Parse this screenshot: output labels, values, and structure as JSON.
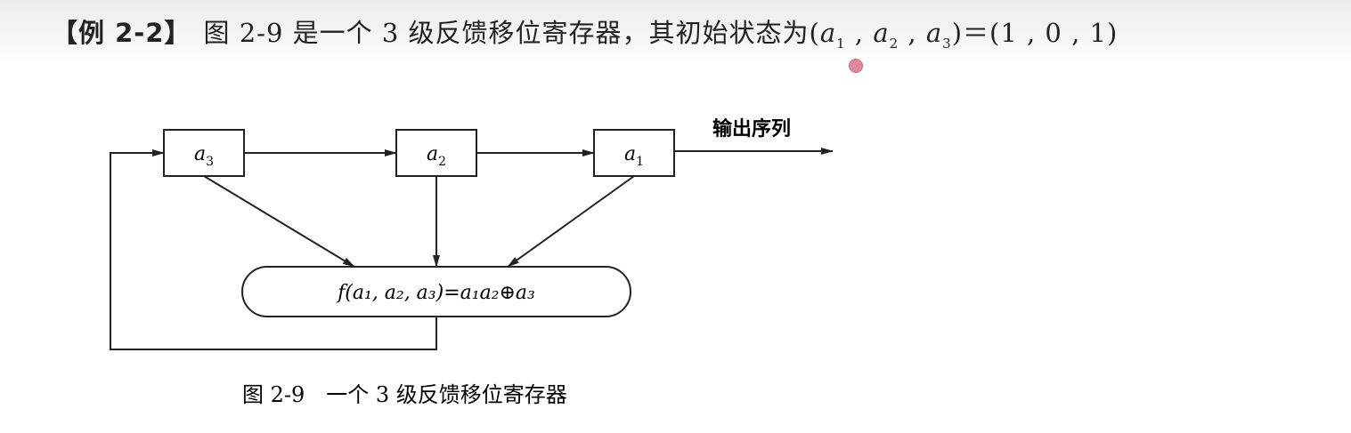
{
  "header": {
    "example_label": "【例 2-2】",
    "text_intro": "图 2-9 是一个 3 级反馈移位寄存器，其初始状态为(",
    "var_a": "a",
    "sub1": "1",
    "sub2": "2",
    "sub3": "3",
    "sep": " , ",
    "text_mid": ")＝(",
    "state_values": "1 , 0 , 1",
    "text_end": ")"
  },
  "diagram": {
    "registers": [
      {
        "var": "a",
        "sub": "3"
      },
      {
        "var": "a",
        "sub": "2"
      },
      {
        "var": "a",
        "sub": "1"
      }
    ],
    "output_label": "输出序列",
    "function_label": "f(a₁, a₂, a₃)=a₁a₂⊕a₃",
    "caption": "图 2-9　一个 3 级反馈移位寄存器"
  },
  "colors": {
    "line": "#222222",
    "pointer_dot": "#e0889a"
  }
}
